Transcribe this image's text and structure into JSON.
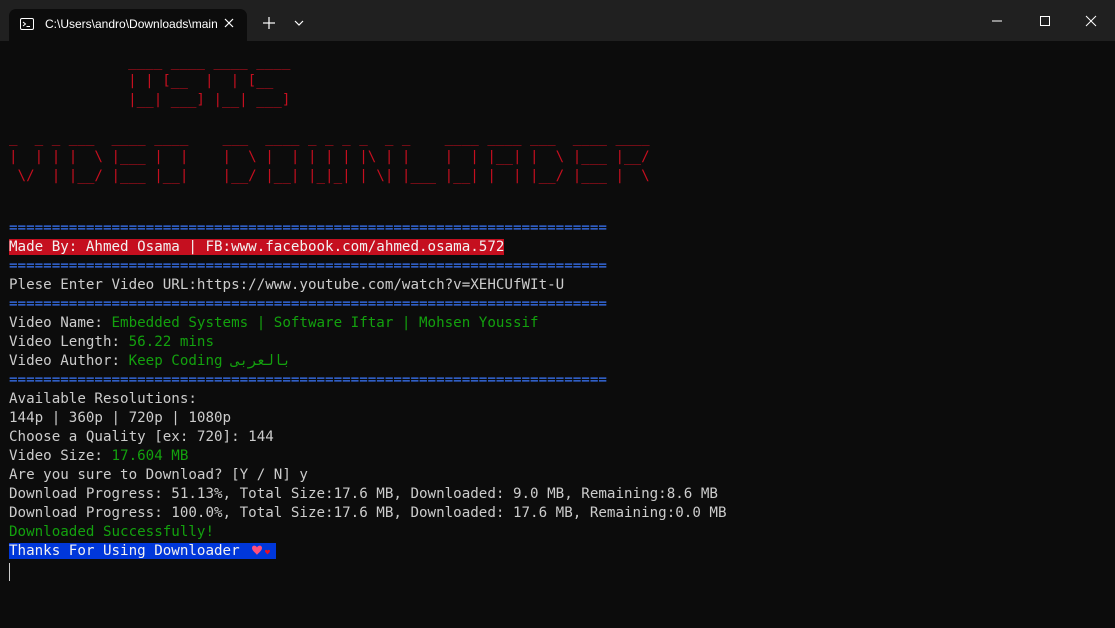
{
  "tab": {
    "title": "C:\\Users\\andro\\Downloads\\main",
    "icon": "terminal-icon"
  },
  "colors": {
    "titlebar": "#202020",
    "background": "#0c0c0c",
    "ascii": "#c50f1f",
    "separator": "#3b78ff",
    "value_green": "#13a10e",
    "highlight_red": "#c50f1f",
    "highlight_blue": "#0037da"
  },
  "ascii_art": {
    "line1": "  ____ ____ ____ ____",
    "line2": "  | | [__  |  | [__ ",
    "line3": "  |__| ___] |__| ___]",
    "line4": "_  _ _ ___  ____ ____    ___  ____ _ _ _ _  _ _    ____ ____ ___  ____ ____",
    "line5": "|  | | |  \\ |___ |  |    |  \\ |  | | | | |\\ | |    |  | |__| |  \\ |___ |__/",
    "line6": " \\/  | |__/ |___ |__|    |__/ |__| |_|_| | \\| |___ |__| |  | |__/ |___ |  \\"
  },
  "separator": "======================================================================",
  "credits": "Made By: Ahmed Osama | FB:www.facebook.com/ahmed.osama.572",
  "prompt_url": {
    "label": "Plese Enter Video URL:",
    "value": "https://www.youtube.com/watch?v=XEHCUfWIt-U"
  },
  "video_info": {
    "name_label": "Video Name: ",
    "name_value": "Embedded Systems | Software Iftar | Mohsen Youssif",
    "length_label": "Video Length: ",
    "length_value": "56.22 mins",
    "author_label": "Video Author: ",
    "author_value": "Keep Coding بالعربى"
  },
  "resolutions": {
    "heading": "Available Resolutions:",
    "list": "144p | 360p | 720p | 1080p",
    "choose": "Choose a Quality [ex: 720]: 144",
    "size_label": "Video Size: ",
    "size_value": "17.604 MB"
  },
  "download": {
    "confirm": "Are you sure to Download? [Y / N] y",
    "progress1": "Download Progress: 51.13%, Total Size:17.6 MB, Downloaded: 9.0 MB, Remaining:8.6 MB",
    "progress2": "Download Progress: 100.0%, Total Size:17.6 MB, Downloaded: 17.6 MB, Remaining:0.0 MB",
    "success": "Downloaded Successfully!",
    "thanks": "Thanks For Using Downloader "
  }
}
